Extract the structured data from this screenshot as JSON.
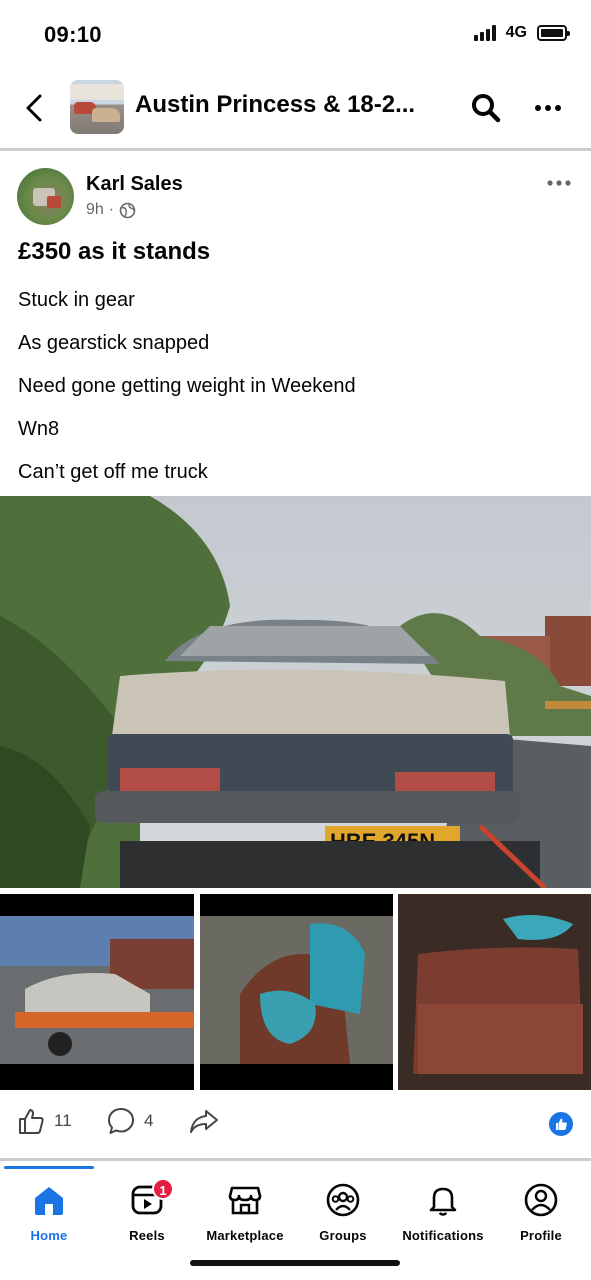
{
  "status_bar": {
    "time": "09:10",
    "network": "4G"
  },
  "header": {
    "group_title": "Austin Princess & 18-2..."
  },
  "post": {
    "author": "Karl Sales",
    "time_ago": "9h",
    "separator": "·",
    "title": "£350 as it stands",
    "lines": [
      "Stuck in gear",
      "As gearstick snapped",
      "Need gone getting weight in Weekend",
      "Wn8",
      "Can’t get off me truck"
    ],
    "main_photo": {
      "plate_text": "HBE 345N"
    },
    "reactions": {
      "likes": "11",
      "comments": "4"
    }
  },
  "tabbar": {
    "tabs": [
      {
        "label": "Home"
      },
      {
        "label": "Reels",
        "badge": "1"
      },
      {
        "label": "Marketplace"
      },
      {
        "label": "Groups"
      },
      {
        "label": "Notifications"
      },
      {
        "label": "Profile"
      }
    ]
  },
  "colors": {
    "accent": "#1b74e4",
    "badge_red": "#e41e3f",
    "secondary_text": "#65676b",
    "divider": "#c9ccd1"
  },
  "icons": [
    "back-arrow-icon",
    "search-icon",
    "more-icon",
    "globe-icon",
    "like-icon",
    "comment-icon",
    "share-icon",
    "like-reaction-icon",
    "home-icon",
    "reels-icon",
    "marketplace-icon",
    "groups-icon",
    "bell-icon",
    "profile-icon"
  ]
}
